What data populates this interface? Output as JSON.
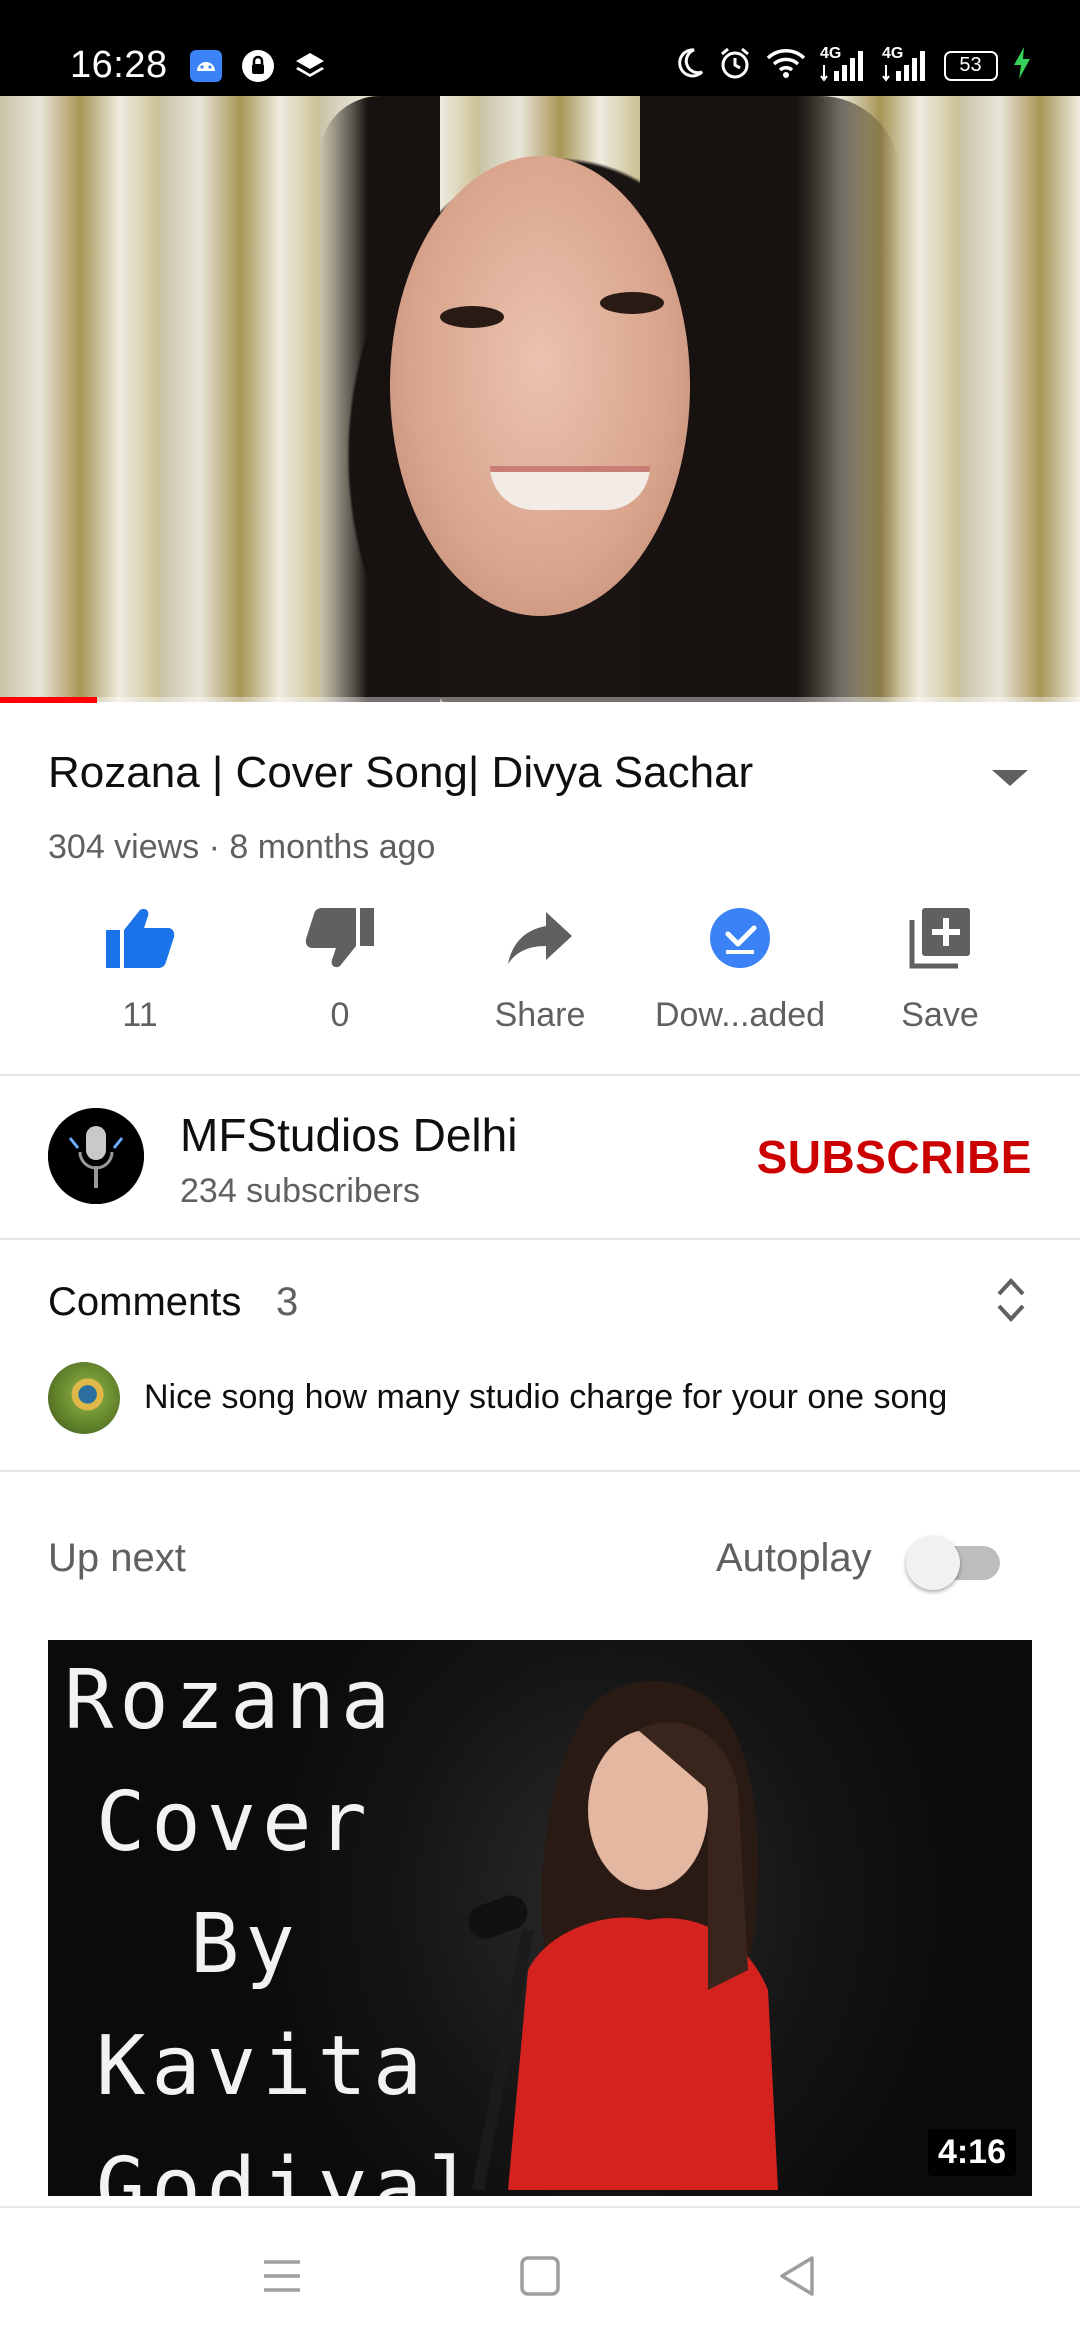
{
  "status_bar": {
    "time": "16:28",
    "battery": "53",
    "network_1": "4G",
    "network_2": "4G",
    "left_icons": [
      "android-icon",
      "lock-badge-icon",
      "layers-icon"
    ],
    "right_icons": [
      "moon-icon",
      "alarm-icon",
      "wifi-icon",
      "signal-icon",
      "signal-icon",
      "battery-icon",
      "charging-icon"
    ]
  },
  "player": {
    "progress": 0.09,
    "progress_color": "#ff0000"
  },
  "video": {
    "title": "Rozana | Cover Song| Divya Sachar",
    "meta": "304 views · 8 months ago"
  },
  "actions": [
    {
      "label": "11",
      "icon": "like-icon"
    },
    {
      "label": "0",
      "icon": "dislike-icon"
    },
    {
      "label": "Share",
      "icon": "share-icon"
    },
    {
      "label": "Dow...aded",
      "icon": "downloaded-icon"
    },
    {
      "label": "Save",
      "icon": "save-to-playlist-icon"
    }
  ],
  "channel": {
    "name": "MFStudios Delhi",
    "subscribers": "234 subscribers",
    "subscribe_label": "SUBSCRIBE",
    "subscribe_color": "#cc0000"
  },
  "comments": {
    "title": "Comments",
    "count": "3",
    "top_comment": "Nice song how many studio charge for your one song"
  },
  "up_next": {
    "title": "Up next",
    "autoplay_label": "Autoplay",
    "autoplay_on": false,
    "thumbnail_lines": [
      "Rozana",
      "Cover",
      "By",
      "Kavita",
      "Godiyal"
    ],
    "duration": "4:16"
  },
  "nav_bar": {
    "buttons": [
      "menu-icon",
      "home-icon",
      "back-icon"
    ]
  }
}
